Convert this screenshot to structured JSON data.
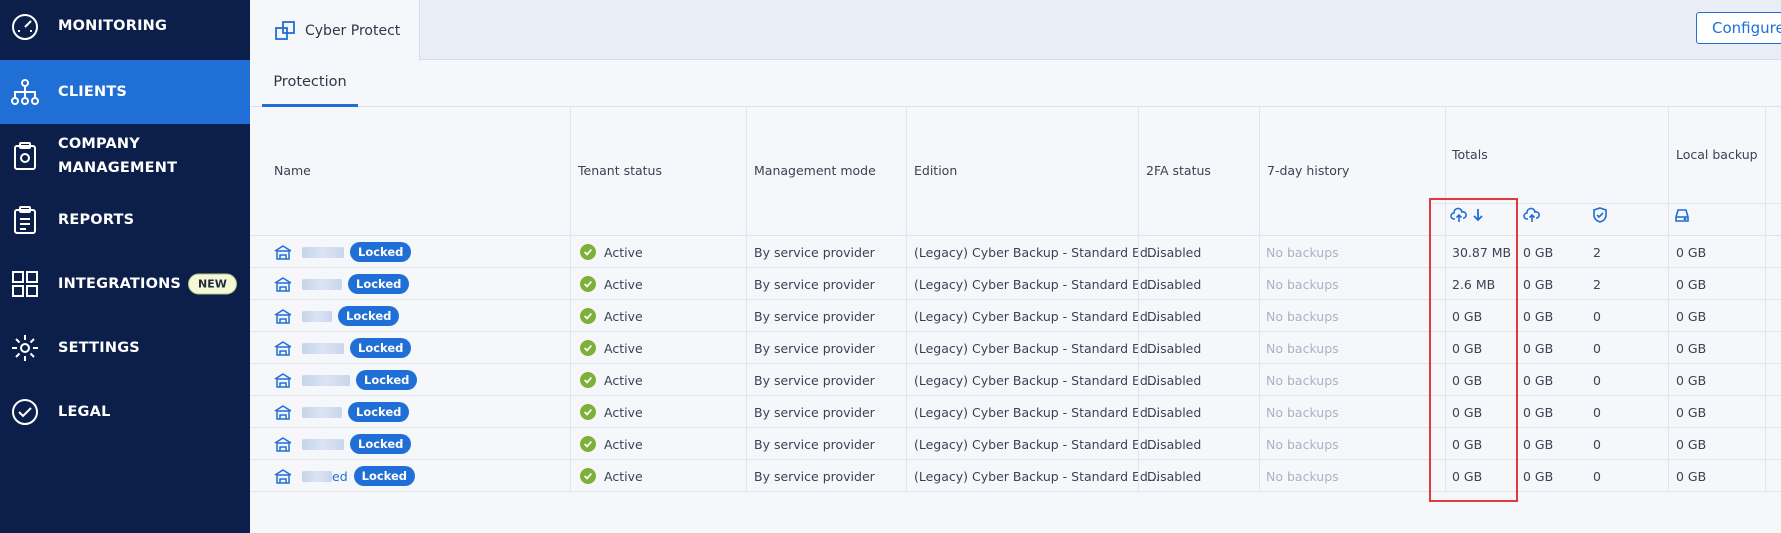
{
  "sidebar": {
    "items": [
      {
        "label": "MONITORING",
        "icon": "speedometer-icon"
      },
      {
        "label": "CLIENTS",
        "icon": "hierarchy-icon",
        "active": true
      },
      {
        "label": "COMPANY\nMANAGEMENT",
        "icon": "clipboard-gear-icon"
      },
      {
        "label": "REPORTS",
        "icon": "report-icon"
      },
      {
        "label": "INTEGRATIONS",
        "icon": "integrations-icon",
        "badge": "NEW"
      },
      {
        "label": "SETTINGS",
        "icon": "gear-icon"
      },
      {
        "label": "LEGAL",
        "icon": "check-circle-icon"
      }
    ]
  },
  "topbar": {
    "tab_label": "Cyber Protect",
    "configure_label": "Configure"
  },
  "subtabs": {
    "protection": "Protection"
  },
  "table": {
    "headers": {
      "name": "Name",
      "tenant_status": "Tenant status",
      "management_mode": "Management mode",
      "edition": "Edition",
      "twofa": "2FA status",
      "history": "7-day history",
      "totals": "Totals",
      "local_backup": "Local backup"
    },
    "rows": [
      {
        "name_tail": "",
        "badge": "Locked",
        "status": "Active",
        "mode": "By service provider",
        "edition": "(Legacy) Cyber Backup - Standard Ed...",
        "twofa": "Disabled",
        "history": "No backups",
        "size": "30.87 MB",
        "cloud": "0 GB",
        "protected": "2",
        "local": "0 GB"
      },
      {
        "name_tail": "",
        "badge": "Locked",
        "status": "Active",
        "mode": "By service provider",
        "edition": "(Legacy) Cyber Backup - Standard Ed...",
        "twofa": "Disabled",
        "history": "No backups",
        "size": "2.6 MB",
        "cloud": "0 GB",
        "protected": "2",
        "local": "0 GB"
      },
      {
        "name_tail": "",
        "badge": "Locked",
        "status": "Active",
        "mode": "By service provider",
        "edition": "(Legacy) Cyber Backup - Standard Ed...",
        "twofa": "Disabled",
        "history": "No backups",
        "size": "0 GB",
        "cloud": "0 GB",
        "protected": "0",
        "local": "0 GB"
      },
      {
        "name_tail": "",
        "badge": "Locked",
        "status": "Active",
        "mode": "By service provider",
        "edition": "(Legacy) Cyber Backup - Standard Ed...",
        "twofa": "Disabled",
        "history": "No backups",
        "size": "0 GB",
        "cloud": "0 GB",
        "protected": "0",
        "local": "0 GB"
      },
      {
        "name_tail": "",
        "badge": "Locked",
        "status": "Active",
        "mode": "By service provider",
        "edition": "(Legacy) Cyber Backup - Standard Ed...",
        "twofa": "Disabled",
        "history": "No backups",
        "size": "0 GB",
        "cloud": "0 GB",
        "protected": "0",
        "local": "0 GB"
      },
      {
        "name_tail": "",
        "badge": "Locked",
        "status": "Active",
        "mode": "By service provider",
        "edition": "(Legacy) Cyber Backup - Standard Ed...",
        "twofa": "Disabled",
        "history": "No backups",
        "size": "0 GB",
        "cloud": "0 GB",
        "protected": "0",
        "local": "0 GB"
      },
      {
        "name_tail": "",
        "badge": "Locked",
        "status": "Active",
        "mode": "By service provider",
        "edition": "(Legacy) Cyber Backup - Standard Ed...",
        "twofa": "Disabled",
        "history": "No backups",
        "size": "0 GB",
        "cloud": "0 GB",
        "protected": "0",
        "local": "0 GB"
      },
      {
        "name_tail": "ed",
        "badge": "Locked",
        "status": "Active",
        "mode": "By service provider",
        "edition": "(Legacy) Cyber Backup - Standard Ed...",
        "twofa": "Disabled",
        "history": "No backups",
        "size": "0 GB",
        "cloud": "0 GB",
        "protected": "0",
        "local": "0 GB"
      }
    ]
  },
  "colors": {
    "sidebar_bg": "#0b1f4a",
    "accent": "#1f6fd6",
    "active_green": "#7fb03a",
    "highlight_red": "#e0393e"
  }
}
